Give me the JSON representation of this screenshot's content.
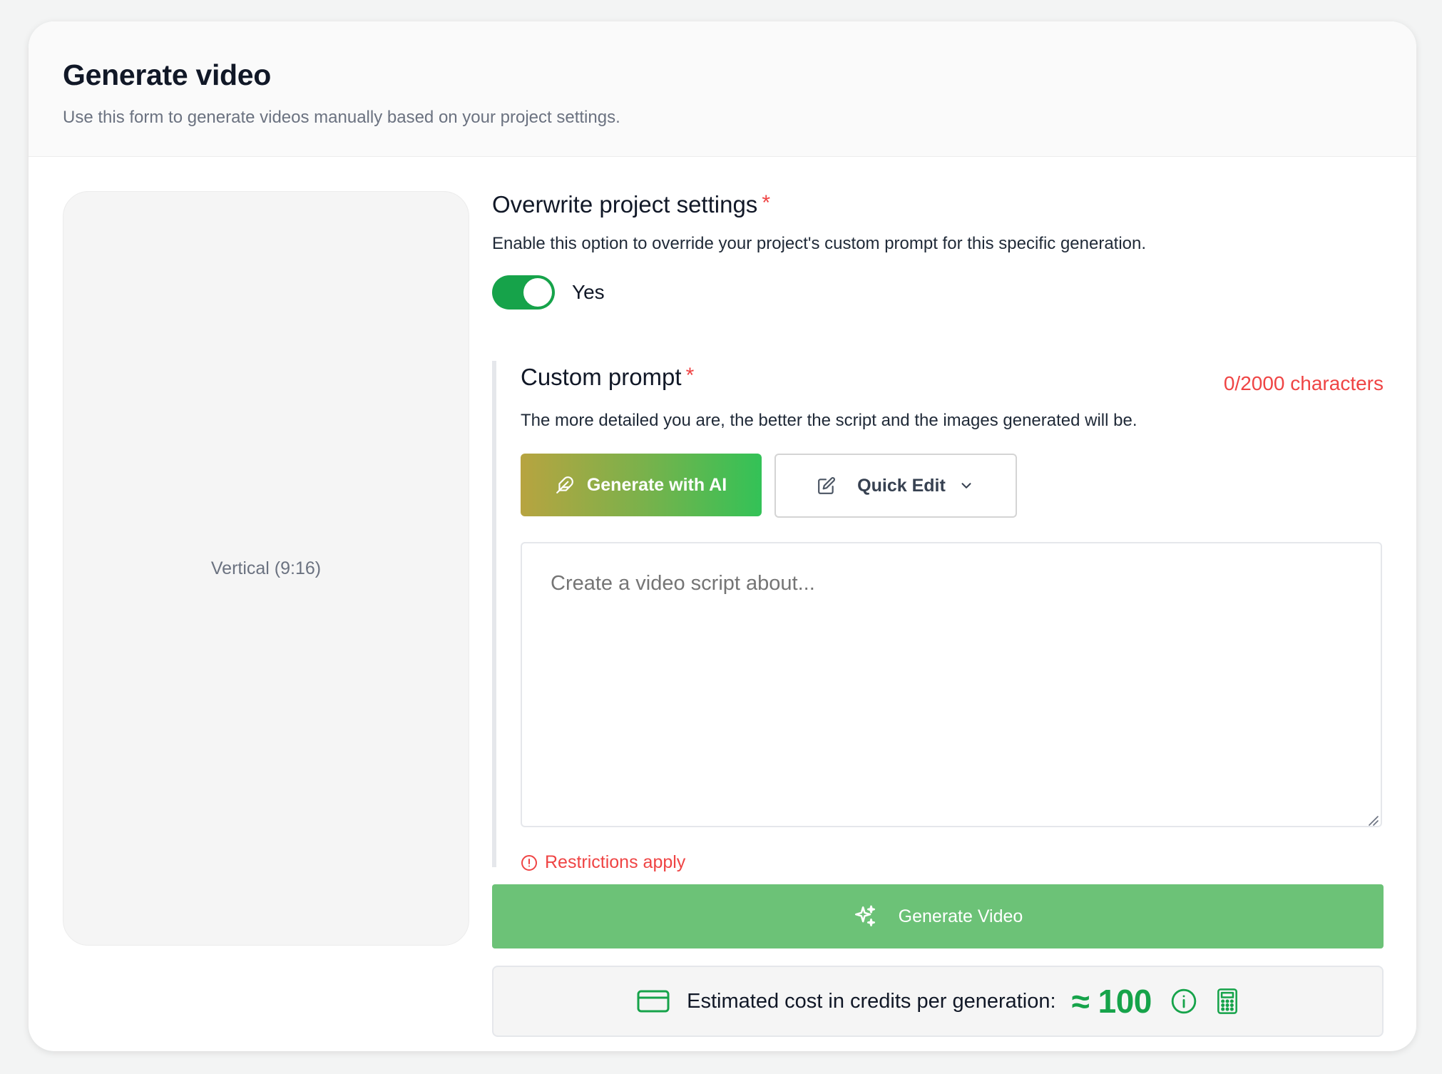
{
  "header": {
    "title": "Generate video",
    "subtitle": "Use this form to generate videos manually based on your project settings."
  },
  "preview": {
    "label": "Vertical (9:16)"
  },
  "overwrite": {
    "title": "Overwrite project settings",
    "required_mark": "*",
    "description": "Enable this option to override your project's custom prompt for this specific generation.",
    "toggle_on": true,
    "toggle_label": "Yes"
  },
  "prompt": {
    "title": "Custom prompt",
    "required_mark": "*",
    "char_count": "0/2000 characters",
    "description": "The more detailed you are, the better the script and the images generated will be.",
    "generate_ai_label": "Generate with AI",
    "quick_edit_label": "Quick Edit",
    "value": "",
    "placeholder": "Create a video script about...",
    "restrictions": "Restrictions apply"
  },
  "actions": {
    "generate_video_label": "Generate Video"
  },
  "cost": {
    "label": "Estimated cost in credits per generation:",
    "value": "≈ 100"
  },
  "colors": {
    "accent_green": "#16a34a",
    "generate_button": "#6cc277",
    "error_red": "#ef4444"
  },
  "icons": {
    "ai_button": "feather-icon",
    "quick_edit": "pencil-square-icon",
    "dropdown": "chevron-down-icon",
    "restrictions": "alert-circle-icon",
    "generate": "sparkles-icon",
    "cost": "credit-card-icon",
    "info": "info-icon",
    "calculator": "calculator-icon"
  }
}
